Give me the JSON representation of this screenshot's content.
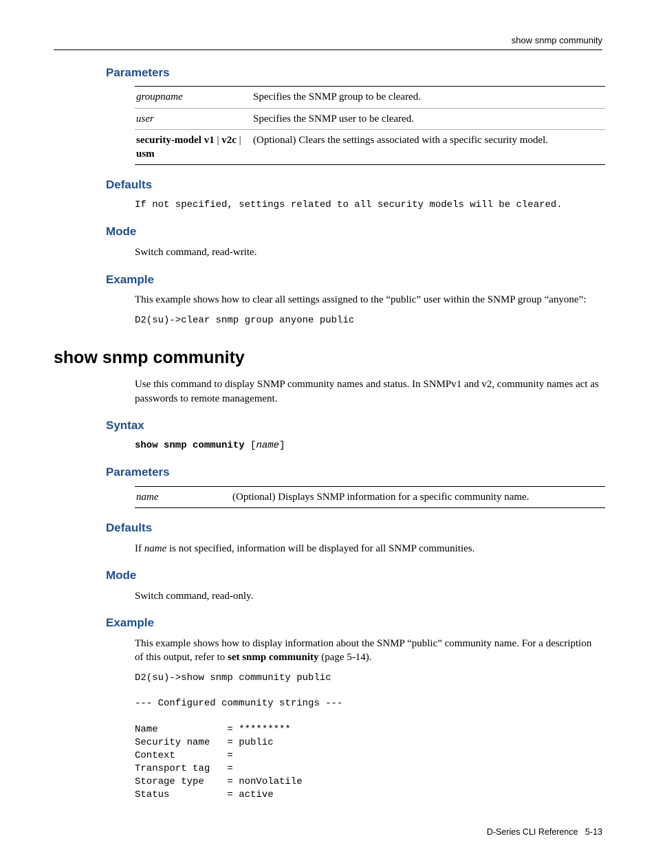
{
  "header": {
    "right": "show snmp community"
  },
  "sec1": {
    "parameters_heading": "Parameters",
    "param_rows": [
      {
        "name": "groupname",
        "name_style": "italic",
        "desc": "Specifies the SNMP group to be cleared."
      },
      {
        "name": "user",
        "name_style": "italic",
        "desc": "Specifies the SNMP user to be cleared."
      },
      {
        "name_html": "security-model v1 | v2c | usm",
        "name_bold": "security-model v1",
        "name_mid": " | ",
        "name_bold2": "v2c",
        "name_mid2": " | ",
        "name_bold3": "usm",
        "desc": "(Optional) Clears the settings associated with a specific security model."
      }
    ],
    "defaults_heading": "Defaults",
    "defaults_text": "If not specified, settings related to all security models will be cleared.",
    "mode_heading": "Mode",
    "mode_text": "Switch command, read-write.",
    "example_heading": "Example",
    "example_text": "This example shows how to clear all settings assigned to the “public” user within the SNMP group “anyone”:",
    "example_code": "D2(su)->clear snmp group anyone public"
  },
  "cmd": {
    "title": "show snmp community",
    "intro": "Use this command to display SNMP community names and status. In SNMPv1 and v2, community names act as passwords to remote management.",
    "syntax_heading": "Syntax",
    "syntax_bold": "show snmp community",
    "syntax_rest": " [",
    "syntax_italic": "name",
    "syntax_close": "]",
    "parameters_heading": "Parameters",
    "param_name": "name",
    "param_desc": "(Optional) Displays SNMP information for a specific community name.",
    "defaults_heading": "Defaults",
    "defaults_pre": "If ",
    "defaults_italic": "name",
    "defaults_post": " is not specified, information will be displayed for all SNMP communities.",
    "mode_heading": "Mode",
    "mode_text": "Switch command, read-only.",
    "example_heading": "Example",
    "example_text_pre": "This example shows how to display information about the SNMP “public” community name. For a description of this output, refer to ",
    "example_text_bold": "set snmp community",
    "example_text_post": " (page 5-14).",
    "example_code": "D2(su)->show snmp community public\n\n--- Configured community strings ---\n\nName            = *********\nSecurity name   = public\nContext         = \nTransport tag   = \nStorage type    = nonVolatile\nStatus          = active"
  },
  "footer": {
    "text_left": "D-Series CLI Reference",
    "text_right": "5-13"
  }
}
